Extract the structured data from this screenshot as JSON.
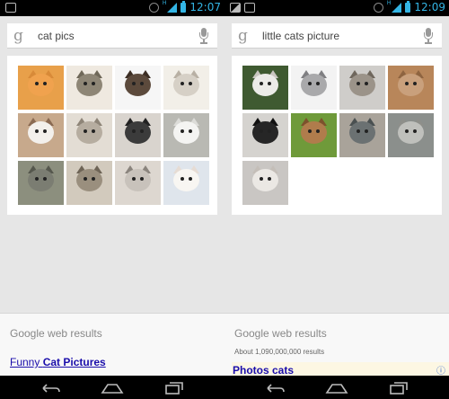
{
  "screens": [
    {
      "status_bar": {
        "time": "12:07",
        "network": "H",
        "notifications": [
          "chat-notification-icon"
        ]
      },
      "search": {
        "query": "cat pics"
      },
      "image_results": [
        {
          "name": "cat-image-1",
          "bg": "#e8a04a",
          "head": "#f0a24e",
          "ear": "#d88a38"
        },
        {
          "name": "cat-image-2",
          "bg": "#efe9e0",
          "head": "#8e8676",
          "ear": "#6f6859"
        },
        {
          "name": "cat-image-3",
          "bg": "#f6f6f6",
          "head": "#5c4a3c",
          "ear": "#3c2e24"
        },
        {
          "name": "cat-image-4",
          "bg": "#f2efe8",
          "head": "#d6d0c6",
          "ear": "#b8b0a4"
        },
        {
          "name": "cat-image-5",
          "bg": "#c7a98c",
          "head": "#f3f0ec",
          "ear": "#8a6a52"
        },
        {
          "name": "cat-image-6",
          "bg": "#e3ddd4",
          "head": "#b6ada0",
          "ear": "#8e8578"
        },
        {
          "name": "cat-image-7",
          "bg": "#d9d4ce",
          "head": "#3b3b3b",
          "ear": "#222222"
        },
        {
          "name": "cat-image-8",
          "bg": "#b9b9b3",
          "head": "#f4f4f2",
          "ear": "#dcdcd8"
        },
        {
          "name": "cat-image-9",
          "bg": "#8c8f7e",
          "head": "#7b7d72",
          "ear": "#55574d"
        },
        {
          "name": "cat-image-10",
          "bg": "#d2cabd",
          "head": "#9a8f7e",
          "ear": "#6e6456"
        },
        {
          "name": "cat-image-11",
          "bg": "#ddd7d0",
          "head": "#c8c2bb",
          "ear": "#8a847d"
        },
        {
          "name": "cat-image-12",
          "bg": "#dfe5ec",
          "head": "#f8f6f2",
          "ear": "#e6dcd4"
        }
      ],
      "web_results": {
        "title": "Google web results",
        "first_result": {
          "prefix": "Funny ",
          "bold": "Cat Pictures"
        }
      }
    },
    {
      "status_bar": {
        "time": "12:09",
        "network": "H",
        "notifications": [
          "picture-notification-icon",
          "chat-notification-icon"
        ]
      },
      "search": {
        "query": "little cats picture"
      },
      "image_results": [
        {
          "name": "cat-image-1",
          "bg": "#3f5a31",
          "head": "#ecebe8",
          "ear": "#c9c6c0"
        },
        {
          "name": "cat-image-2",
          "bg": "#f3f3f3",
          "head": "#a9a9ab",
          "ear": "#7f7f82"
        },
        {
          "name": "cat-image-3",
          "bg": "#cfcdca",
          "head": "#9b9389",
          "ear": "#6f675d"
        },
        {
          "name": "cat-image-4",
          "bg": "#b8865a",
          "head": "#c9a07c",
          "ear": "#8e6440"
        },
        {
          "name": "cat-image-5",
          "bg": "#d5d3cf",
          "head": "#262626",
          "ear": "#111111"
        },
        {
          "name": "cat-image-6",
          "bg": "#6f9a3a",
          "head": "#b07c4c",
          "ear": "#7c522c"
        },
        {
          "name": "cat-image-7",
          "bg": "#a9a39a",
          "head": "#6b7172",
          "ear": "#4a5051"
        },
        {
          "name": "cat-image-8",
          "bg": "#8b8f8c",
          "head": "#bfc0bc",
          "ear": "#8e8f8a"
        },
        {
          "name": "cat-image-9",
          "bg": "#c9c6c3",
          "head": "#ebe8e4",
          "ear": "#c4beb8"
        }
      ],
      "web_results": {
        "title": "Google web results",
        "stats": "About 1,090,000,000 results",
        "first_result": {
          "partial": "Photos cats"
        }
      }
    }
  ]
}
